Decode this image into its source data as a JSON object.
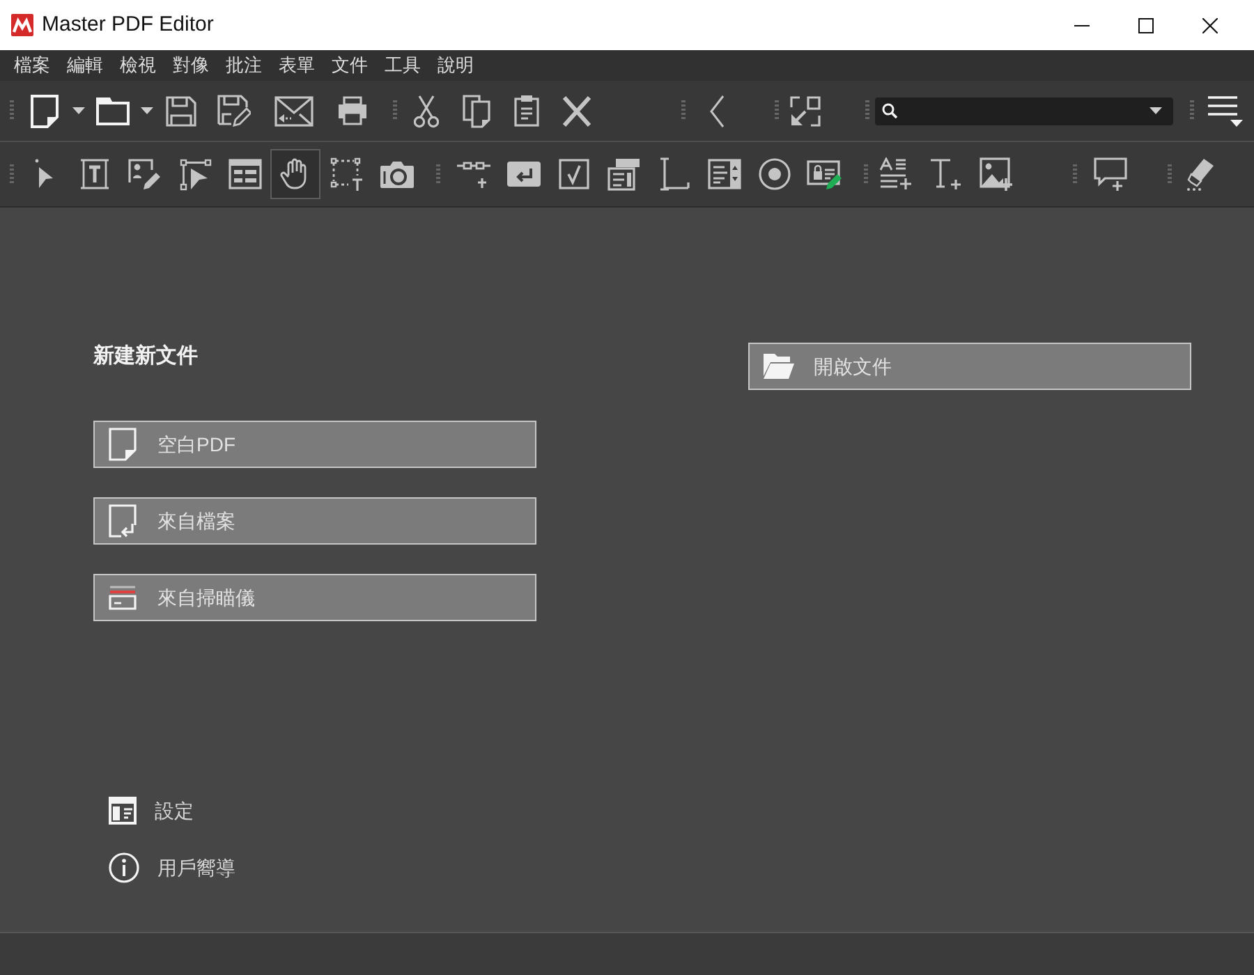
{
  "window": {
    "title": "Master PDF Editor"
  },
  "menu_bar": {
    "items": [
      "檔案",
      "編輯",
      "檢視",
      "對像",
      "批注",
      "表單",
      "文件",
      "工具",
      "說明"
    ]
  },
  "tools_toolbar": {
    "tools": [
      {
        "selected": false
      },
      {
        "selected": false
      },
      {
        "selected": false
      },
      {
        "selected": false
      },
      {
        "selected": false
      },
      {
        "selected": true
      },
      {
        "selected": false
      },
      {
        "selected": false
      },
      {
        "selected": false
      },
      {
        "selected": false
      },
      {
        "selected": false
      },
      {
        "selected": false
      },
      {
        "selected": false
      },
      {
        "selected": false
      },
      {
        "selected": false
      },
      {
        "selected": false
      },
      {
        "selected": false
      },
      {
        "selected": false
      },
      {
        "selected": false
      },
      {
        "selected": false
      },
      {
        "selected": false
      }
    ]
  },
  "start_page": {
    "new_section": {
      "heading": "新建新文件",
      "buttons": [
        {
          "label": "空白PDF"
        },
        {
          "label": "來自檔案"
        },
        {
          "label": "來自掃瞄儀"
        }
      ]
    },
    "open_button": {
      "label": "開啟文件"
    },
    "links": [
      {
        "label": "設定"
      },
      {
        "label": "用戶嚮導"
      }
    ]
  }
}
